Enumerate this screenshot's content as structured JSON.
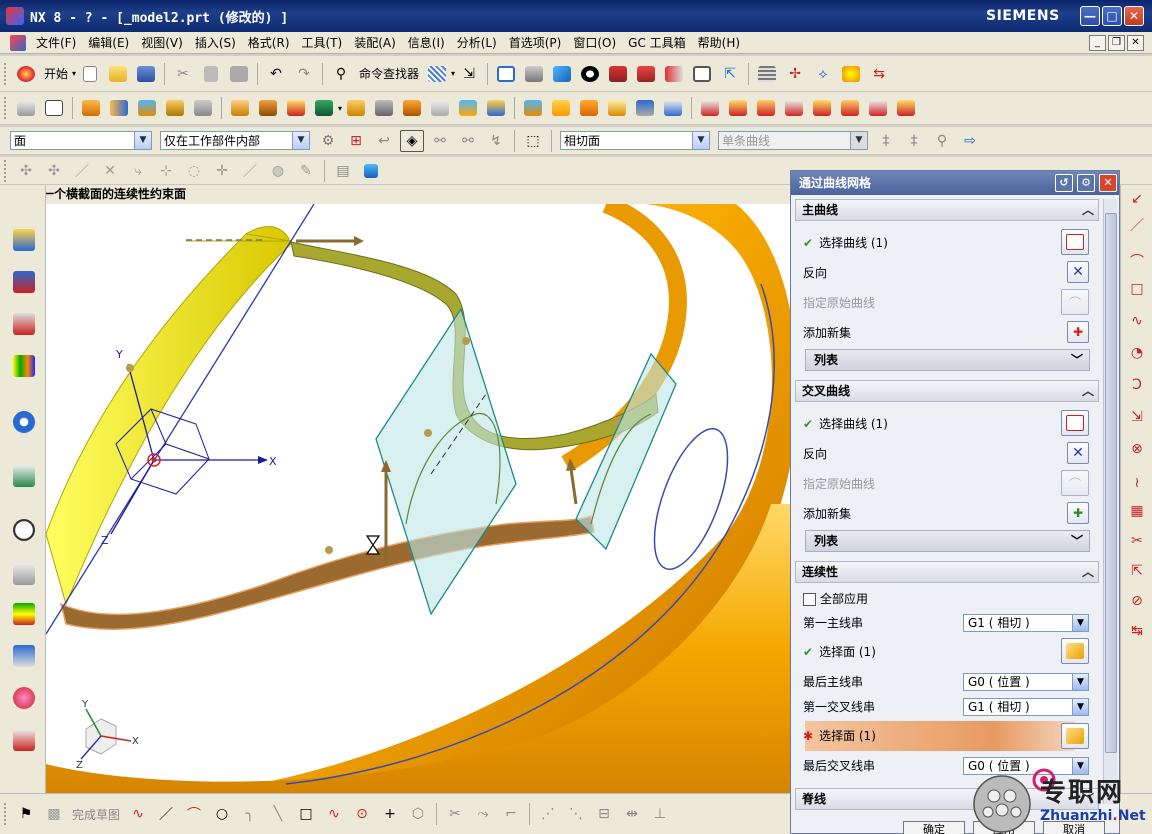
{
  "window": {
    "title": "NX 8 - ? - [_model2.prt  (修改的) ]",
    "brand": "SIEMENS",
    "minimize_glyph": "—",
    "maximize_glyph": "□",
    "close_glyph": "✕"
  },
  "menu": {
    "items": [
      "文件(F)",
      "编辑(E)",
      "视图(V)",
      "插入(S)",
      "格式(R)",
      "工具(T)",
      "装配(A)",
      "信息(I)",
      "分析(L)",
      "首选项(P)",
      "窗口(O)",
      "GC 工具箱",
      "帮助(H)"
    ]
  },
  "toolbar1": {
    "start_label": "开始",
    "command_finder_label": "命令查找器"
  },
  "selection_bar": {
    "filter_value": "面",
    "scope_value": "仅在工作部件内部",
    "face_rule_value": "相切面",
    "curve_rule_value": "单条曲线"
  },
  "status": {
    "prompt": "选择第一个横截面的连续性约束面"
  },
  "viewport": {
    "axis_x": "X",
    "axis_y": "Y",
    "axis_z": "Z",
    "triad_x": "X",
    "triad_y": "Y",
    "triad_z": "Z",
    "colors": {
      "torus": "#f5a800",
      "yellow_ribbon": "#f0e000",
      "brown_ribbon": "#9a6a30",
      "plane": "#bfe6e6",
      "datum": "#1a1aa0"
    }
  },
  "dialog": {
    "title": "通过曲线网格",
    "primary": {
      "header": "主曲线",
      "select_curve": "选择曲线 (1)",
      "reverse": "反向",
      "specify_origin": "指定原始曲线",
      "add_new_set": "添加新集",
      "list": "列表"
    },
    "cross": {
      "header": "交叉曲线",
      "select_curve": "选择曲线 (1)",
      "reverse": "反向",
      "specify_origin": "指定原始曲线",
      "add_new_set": "添加新集",
      "list": "列表"
    },
    "continuity": {
      "header": "连续性",
      "apply_all": "全部应用",
      "first_primary": "第一主线串",
      "first_primary_value": "G1 ( 相切 )",
      "select_face_1": "选择面 (1)",
      "last_primary": "最后主线串",
      "last_primary_value": "G0 ( 位置 )",
      "first_cross": "第一交叉线串",
      "first_cross_value": "G1 ( 相切 )",
      "select_face_2": "选择面 (1)",
      "last_cross": "最后交叉线串",
      "last_cross_value": "G0 ( 位置 )"
    },
    "spine": {
      "header": "脊线"
    },
    "buttons": {
      "ok": "确定",
      "apply": "应用",
      "cancel": "取消"
    }
  },
  "bottom_toolbar": {
    "finish_sketch": "完成草图"
  },
  "watermark": {
    "text": "专职网",
    "url_left": "Zhuanzhi",
    "url_dot": ".",
    "url_right": "Net"
  }
}
